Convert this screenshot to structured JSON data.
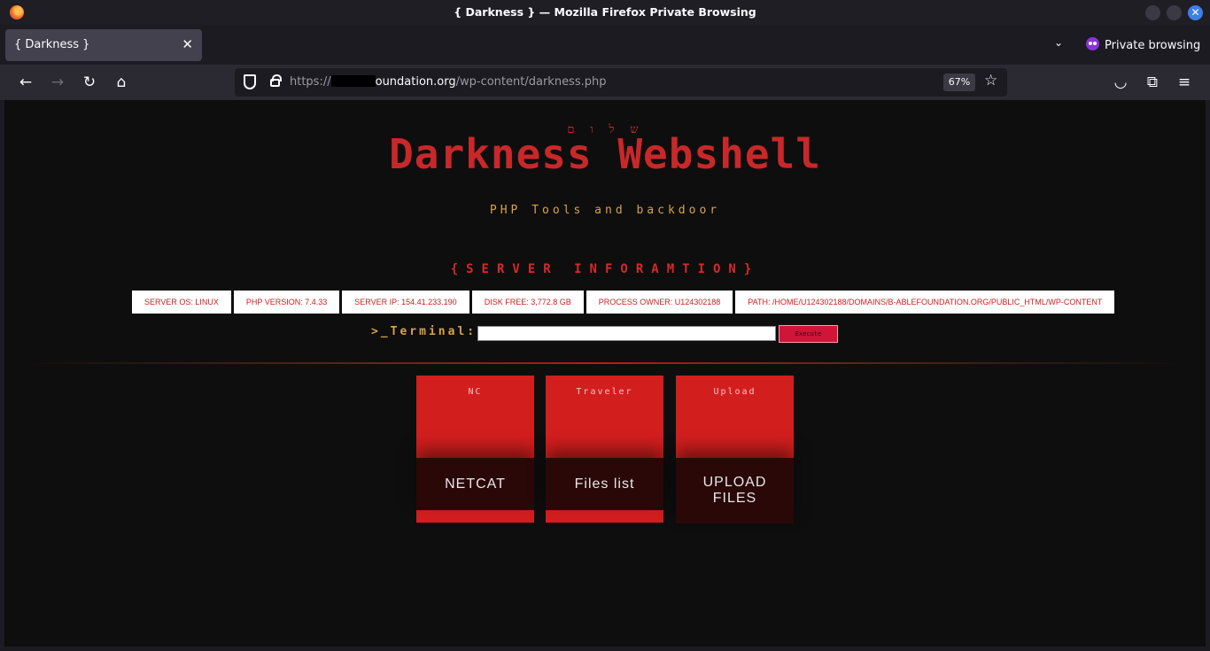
{
  "window": {
    "title": "{ Darkness } — Mozilla Firefox Private Browsing",
    "close_symbol": "✕"
  },
  "tabs": [
    {
      "label": "{ Darkness }",
      "close_symbol": "✕"
    }
  ],
  "tabbar": {
    "list_all_tabs_symbol": "⌄",
    "private_label": "Private browsing"
  },
  "nav": {
    "back_symbol": "←",
    "forward_symbol": "→",
    "reload_symbol": "↻",
    "home_symbol": "⌂",
    "pocket_symbol": "◡",
    "extensions_symbol": "⧉",
    "menu_symbol": "≡"
  },
  "urlbar": {
    "url_prefix": "https://",
    "url_host_visible": "oundation.org",
    "url_path": "/wp-content/darkness.php",
    "zoom": "67%",
    "bookmark_symbol": "☆"
  },
  "page": {
    "hebrew_text": "ש ל ו ם",
    "heading": "Darkness Webshell",
    "subtitle": "PHP Tools and backdoor",
    "server_heading": "{SERVER INFORAMTION}",
    "server_info": [
      "SERVER OS: LINUX",
      "PHP VERSION: 7.4.33",
      "SERVER IP: 154.41.233.190",
      "DISK FREE: 3,772.8 GB",
      "PROCESS OWNER: U124302188",
      "PATH: /HOME/U124302188/DOMAINS/B-ABLEFOUNDATION.ORG/PUBLIC_HTML/WP-CONTENT"
    ],
    "terminal_label": ">_Terminal:",
    "terminal_value": "",
    "execute_label": "Execute",
    "cards": [
      {
        "label": "NC",
        "title": "NETCAT"
      },
      {
        "label": "Traveler",
        "title": "Files list"
      },
      {
        "label": "Upload",
        "title": "UPLOAD FILES"
      }
    ]
  },
  "colors": {
    "accent_red": "#d31e1e",
    "heading_red": "#c8282a",
    "gold": "#d6a24a",
    "page_background": "#0e0e0e"
  }
}
